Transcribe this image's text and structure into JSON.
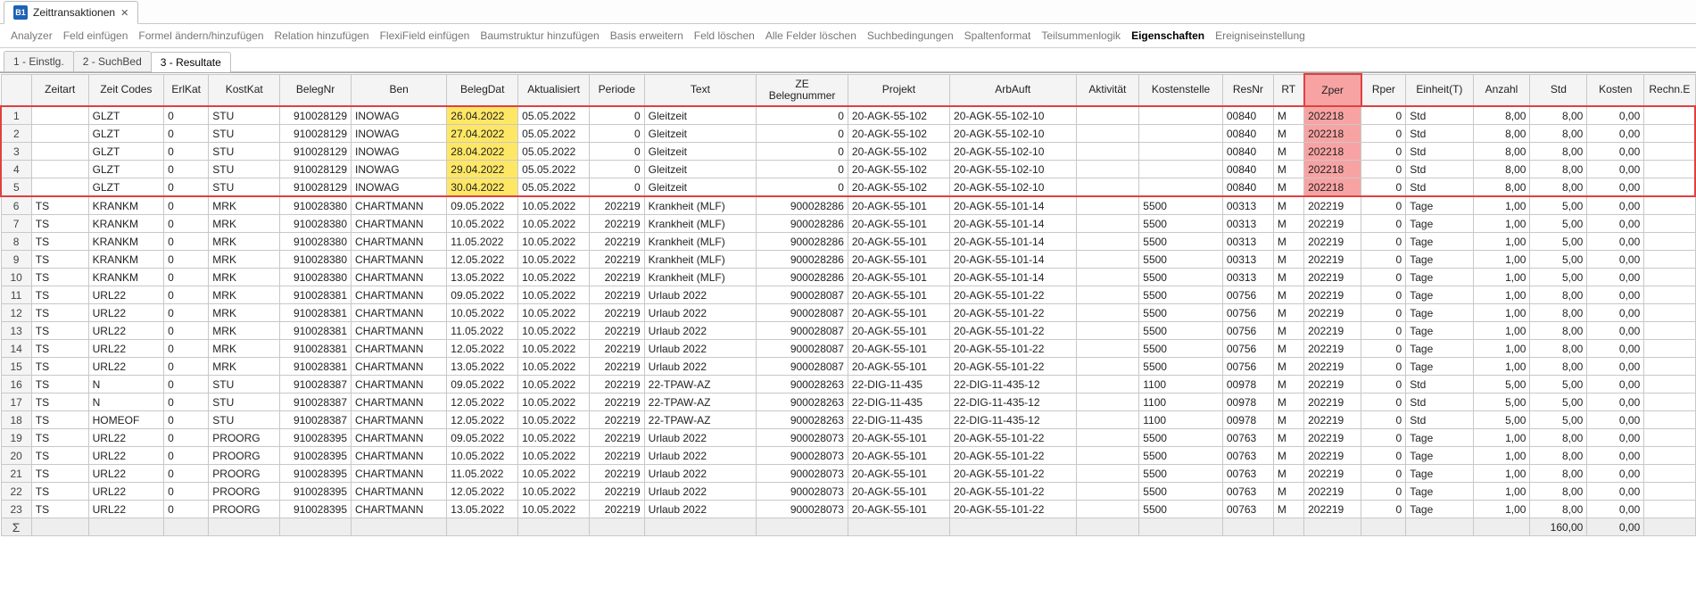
{
  "app_icon_text": "B1",
  "window_title": "Zeittransaktionen",
  "menu": {
    "items": [
      "Analyzer",
      "Feld einfügen",
      "Formel ändern/hinzufügen",
      "Relation hinzufügen",
      "FlexiField einfügen",
      "Baumstruktur hinzufügen",
      "Basis erweitern",
      "Feld löschen",
      "Alle Felder löschen",
      "Suchbedingungen",
      "Spaltenformat",
      "Teilsummenlogik",
      "Eigenschaften",
      "Ereigniseinstellung"
    ],
    "active_index": 12
  },
  "sub_tabs": {
    "items": [
      "1 - Einstlg.",
      "2 - SuchBed",
      "3 - Resultate"
    ],
    "active_index": 2
  },
  "columns": [
    "",
    "Zeitart",
    "Zeit Codes",
    "ErlKat",
    "KostKat",
    "BelegNr",
    "Ben",
    "BelegDat",
    "Aktualisiert",
    "Periode",
    "Text",
    "ZE Belegnummer",
    "Projekt",
    "ArbAuft",
    "Aktivität",
    "Kostenstelle",
    "ResNr",
    "RT",
    "Zper",
    "Rper",
    "Einheit(T)",
    "Anzahl",
    "Std",
    "Kosten",
    "Rechn.E"
  ],
  "highlight_rows": 5,
  "rows": [
    {
      "n": "1",
      "zeitart": "",
      "zc": "GLZT",
      "erl": "0",
      "kk": "STU",
      "bnr": "910028129",
      "ben": "INOWAG",
      "bdat": "26.04.2022",
      "akt": "05.05.2022",
      "per": "0",
      "text": "Gleitzeit",
      "zeb": "0",
      "proj": "20-AGK-55-102",
      "arb": "20-AGK-55-102-10",
      "aktv": "",
      "kost": "",
      "res": "00840",
      "rt": "M",
      "zper": "202218",
      "rper": "0",
      "einh": "Std",
      "anz": "8,00",
      "std": "8,00",
      "kosten": "0,00",
      "rechn": ""
    },
    {
      "n": "2",
      "zeitart": "",
      "zc": "GLZT",
      "erl": "0",
      "kk": "STU",
      "bnr": "910028129",
      "ben": "INOWAG",
      "bdat": "27.04.2022",
      "akt": "05.05.2022",
      "per": "0",
      "text": "Gleitzeit",
      "zeb": "0",
      "proj": "20-AGK-55-102",
      "arb": "20-AGK-55-102-10",
      "aktv": "",
      "kost": "",
      "res": "00840",
      "rt": "M",
      "zper": "202218",
      "rper": "0",
      "einh": "Std",
      "anz": "8,00",
      "std": "8,00",
      "kosten": "0,00",
      "rechn": ""
    },
    {
      "n": "3",
      "zeitart": "",
      "zc": "GLZT",
      "erl": "0",
      "kk": "STU",
      "bnr": "910028129",
      "ben": "INOWAG",
      "bdat": "28.04.2022",
      "akt": "05.05.2022",
      "per": "0",
      "text": "Gleitzeit",
      "zeb": "0",
      "proj": "20-AGK-55-102",
      "arb": "20-AGK-55-102-10",
      "aktv": "",
      "kost": "",
      "res": "00840",
      "rt": "M",
      "zper": "202218",
      "rper": "0",
      "einh": "Std",
      "anz": "8,00",
      "std": "8,00",
      "kosten": "0,00",
      "rechn": ""
    },
    {
      "n": "4",
      "zeitart": "",
      "zc": "GLZT",
      "erl": "0",
      "kk": "STU",
      "bnr": "910028129",
      "ben": "INOWAG",
      "bdat": "29.04.2022",
      "akt": "05.05.2022",
      "per": "0",
      "text": "Gleitzeit",
      "zeb": "0",
      "proj": "20-AGK-55-102",
      "arb": "20-AGK-55-102-10",
      "aktv": "",
      "kost": "",
      "res": "00840",
      "rt": "M",
      "zper": "202218",
      "rper": "0",
      "einh": "Std",
      "anz": "8,00",
      "std": "8,00",
      "kosten": "0,00",
      "rechn": ""
    },
    {
      "n": "5",
      "zeitart": "",
      "zc": "GLZT",
      "erl": "0",
      "kk": "STU",
      "bnr": "910028129",
      "ben": "INOWAG",
      "bdat": "30.04.2022",
      "akt": "05.05.2022",
      "per": "0",
      "text": "Gleitzeit",
      "zeb": "0",
      "proj": "20-AGK-55-102",
      "arb": "20-AGK-55-102-10",
      "aktv": "",
      "kost": "",
      "res": "00840",
      "rt": "M",
      "zper": "202218",
      "rper": "0",
      "einh": "Std",
      "anz": "8,00",
      "std": "8,00",
      "kosten": "0,00",
      "rechn": ""
    },
    {
      "n": "6",
      "zeitart": "TS",
      "zc": "KRANKM",
      "erl": "0",
      "kk": "MRK",
      "bnr": "910028380",
      "ben": "CHARTMANN",
      "bdat": "09.05.2022",
      "akt": "10.05.2022",
      "per": "202219",
      "text": "Krankheit (MLF)",
      "zeb": "900028286",
      "proj": "20-AGK-55-101",
      "arb": "20-AGK-55-101-14",
      "aktv": "",
      "kost": "5500",
      "res": "00313",
      "rt": "M",
      "zper": "202219",
      "rper": "0",
      "einh": "Tage",
      "anz": "1,00",
      "std": "5,00",
      "kosten": "0,00",
      "rechn": ""
    },
    {
      "n": "7",
      "zeitart": "TS",
      "zc": "KRANKM",
      "erl": "0",
      "kk": "MRK",
      "bnr": "910028380",
      "ben": "CHARTMANN",
      "bdat": "10.05.2022",
      "akt": "10.05.2022",
      "per": "202219",
      "text": "Krankheit (MLF)",
      "zeb": "900028286",
      "proj": "20-AGK-55-101",
      "arb": "20-AGK-55-101-14",
      "aktv": "",
      "kost": "5500",
      "res": "00313",
      "rt": "M",
      "zper": "202219",
      "rper": "0",
      "einh": "Tage",
      "anz": "1,00",
      "std": "5,00",
      "kosten": "0,00",
      "rechn": ""
    },
    {
      "n": "8",
      "zeitart": "TS",
      "zc": "KRANKM",
      "erl": "0",
      "kk": "MRK",
      "bnr": "910028380",
      "ben": "CHARTMANN",
      "bdat": "11.05.2022",
      "akt": "10.05.2022",
      "per": "202219",
      "text": "Krankheit (MLF)",
      "zeb": "900028286",
      "proj": "20-AGK-55-101",
      "arb": "20-AGK-55-101-14",
      "aktv": "",
      "kost": "5500",
      "res": "00313",
      "rt": "M",
      "zper": "202219",
      "rper": "0",
      "einh": "Tage",
      "anz": "1,00",
      "std": "5,00",
      "kosten": "0,00",
      "rechn": ""
    },
    {
      "n": "9",
      "zeitart": "TS",
      "zc": "KRANKM",
      "erl": "0",
      "kk": "MRK",
      "bnr": "910028380",
      "ben": "CHARTMANN",
      "bdat": "12.05.2022",
      "akt": "10.05.2022",
      "per": "202219",
      "text": "Krankheit (MLF)",
      "zeb": "900028286",
      "proj": "20-AGK-55-101",
      "arb": "20-AGK-55-101-14",
      "aktv": "",
      "kost": "5500",
      "res": "00313",
      "rt": "M",
      "zper": "202219",
      "rper": "0",
      "einh": "Tage",
      "anz": "1,00",
      "std": "5,00",
      "kosten": "0,00",
      "rechn": ""
    },
    {
      "n": "10",
      "zeitart": "TS",
      "zc": "KRANKM",
      "erl": "0",
      "kk": "MRK",
      "bnr": "910028380",
      "ben": "CHARTMANN",
      "bdat": "13.05.2022",
      "akt": "10.05.2022",
      "per": "202219",
      "text": "Krankheit (MLF)",
      "zeb": "900028286",
      "proj": "20-AGK-55-101",
      "arb": "20-AGK-55-101-14",
      "aktv": "",
      "kost": "5500",
      "res": "00313",
      "rt": "M",
      "zper": "202219",
      "rper": "0",
      "einh": "Tage",
      "anz": "1,00",
      "std": "5,00",
      "kosten": "0,00",
      "rechn": ""
    },
    {
      "n": "11",
      "zeitart": "TS",
      "zc": "URL22",
      "erl": "0",
      "kk": "MRK",
      "bnr": "910028381",
      "ben": "CHARTMANN",
      "bdat": "09.05.2022",
      "akt": "10.05.2022",
      "per": "202219",
      "text": "Urlaub 2022",
      "zeb": "900028087",
      "proj": "20-AGK-55-101",
      "arb": "20-AGK-55-101-22",
      "aktv": "",
      "kost": "5500",
      "res": "00756",
      "rt": "M",
      "zper": "202219",
      "rper": "0",
      "einh": "Tage",
      "anz": "1,00",
      "std": "8,00",
      "kosten": "0,00",
      "rechn": ""
    },
    {
      "n": "12",
      "zeitart": "TS",
      "zc": "URL22",
      "erl": "0",
      "kk": "MRK",
      "bnr": "910028381",
      "ben": "CHARTMANN",
      "bdat": "10.05.2022",
      "akt": "10.05.2022",
      "per": "202219",
      "text": "Urlaub 2022",
      "zeb": "900028087",
      "proj": "20-AGK-55-101",
      "arb": "20-AGK-55-101-22",
      "aktv": "",
      "kost": "5500",
      "res": "00756",
      "rt": "M",
      "zper": "202219",
      "rper": "0",
      "einh": "Tage",
      "anz": "1,00",
      "std": "8,00",
      "kosten": "0,00",
      "rechn": ""
    },
    {
      "n": "13",
      "zeitart": "TS",
      "zc": "URL22",
      "erl": "0",
      "kk": "MRK",
      "bnr": "910028381",
      "ben": "CHARTMANN",
      "bdat": "11.05.2022",
      "akt": "10.05.2022",
      "per": "202219",
      "text": "Urlaub 2022",
      "zeb": "900028087",
      "proj": "20-AGK-55-101",
      "arb": "20-AGK-55-101-22",
      "aktv": "",
      "kost": "5500",
      "res": "00756",
      "rt": "M",
      "zper": "202219",
      "rper": "0",
      "einh": "Tage",
      "anz": "1,00",
      "std": "8,00",
      "kosten": "0,00",
      "rechn": ""
    },
    {
      "n": "14",
      "zeitart": "TS",
      "zc": "URL22",
      "erl": "0",
      "kk": "MRK",
      "bnr": "910028381",
      "ben": "CHARTMANN",
      "bdat": "12.05.2022",
      "akt": "10.05.2022",
      "per": "202219",
      "text": "Urlaub 2022",
      "zeb": "900028087",
      "proj": "20-AGK-55-101",
      "arb": "20-AGK-55-101-22",
      "aktv": "",
      "kost": "5500",
      "res": "00756",
      "rt": "M",
      "zper": "202219",
      "rper": "0",
      "einh": "Tage",
      "anz": "1,00",
      "std": "8,00",
      "kosten": "0,00",
      "rechn": ""
    },
    {
      "n": "15",
      "zeitart": "TS",
      "zc": "URL22",
      "erl": "0",
      "kk": "MRK",
      "bnr": "910028381",
      "ben": "CHARTMANN",
      "bdat": "13.05.2022",
      "akt": "10.05.2022",
      "per": "202219",
      "text": "Urlaub 2022",
      "zeb": "900028087",
      "proj": "20-AGK-55-101",
      "arb": "20-AGK-55-101-22",
      "aktv": "",
      "kost": "5500",
      "res": "00756",
      "rt": "M",
      "zper": "202219",
      "rper": "0",
      "einh": "Tage",
      "anz": "1,00",
      "std": "8,00",
      "kosten": "0,00",
      "rechn": ""
    },
    {
      "n": "16",
      "zeitart": "TS",
      "zc": "N",
      "erl": "0",
      "kk": "STU",
      "bnr": "910028387",
      "ben": "CHARTMANN",
      "bdat": "09.05.2022",
      "akt": "10.05.2022",
      "per": "202219",
      "text": "22-TPAW-AZ",
      "zeb": "900028263",
      "proj": "22-DIG-11-435",
      "arb": "22-DIG-11-435-12",
      "aktv": "",
      "kost": "1100",
      "res": "00978",
      "rt": "M",
      "zper": "202219",
      "rper": "0",
      "einh": "Std",
      "anz": "5,00",
      "std": "5,00",
      "kosten": "0,00",
      "rechn": ""
    },
    {
      "n": "17",
      "zeitart": "TS",
      "zc": "N",
      "erl": "0",
      "kk": "STU",
      "bnr": "910028387",
      "ben": "CHARTMANN",
      "bdat": "12.05.2022",
      "akt": "10.05.2022",
      "per": "202219",
      "text": "22-TPAW-AZ",
      "zeb": "900028263",
      "proj": "22-DIG-11-435",
      "arb": "22-DIG-11-435-12",
      "aktv": "",
      "kost": "1100",
      "res": "00978",
      "rt": "M",
      "zper": "202219",
      "rper": "0",
      "einh": "Std",
      "anz": "5,00",
      "std": "5,00",
      "kosten": "0,00",
      "rechn": ""
    },
    {
      "n": "18",
      "zeitart": "TS",
      "zc": "HOMEOF",
      "erl": "0",
      "kk": "STU",
      "bnr": "910028387",
      "ben": "CHARTMANN",
      "bdat": "12.05.2022",
      "akt": "10.05.2022",
      "per": "202219",
      "text": "22-TPAW-AZ",
      "zeb": "900028263",
      "proj": "22-DIG-11-435",
      "arb": "22-DIG-11-435-12",
      "aktv": "",
      "kost": "1100",
      "res": "00978",
      "rt": "M",
      "zper": "202219",
      "rper": "0",
      "einh": "Std",
      "anz": "5,00",
      "std": "5,00",
      "kosten": "0,00",
      "rechn": ""
    },
    {
      "n": "19",
      "zeitart": "TS",
      "zc": "URL22",
      "erl": "0",
      "kk": "PROORG",
      "bnr": "910028395",
      "ben": "CHARTMANN",
      "bdat": "09.05.2022",
      "akt": "10.05.2022",
      "per": "202219",
      "text": "Urlaub 2022",
      "zeb": "900028073",
      "proj": "20-AGK-55-101",
      "arb": "20-AGK-55-101-22",
      "aktv": "",
      "kost": "5500",
      "res": "00763",
      "rt": "M",
      "zper": "202219",
      "rper": "0",
      "einh": "Tage",
      "anz": "1,00",
      "std": "8,00",
      "kosten": "0,00",
      "rechn": ""
    },
    {
      "n": "20",
      "zeitart": "TS",
      "zc": "URL22",
      "erl": "0",
      "kk": "PROORG",
      "bnr": "910028395",
      "ben": "CHARTMANN",
      "bdat": "10.05.2022",
      "akt": "10.05.2022",
      "per": "202219",
      "text": "Urlaub 2022",
      "zeb": "900028073",
      "proj": "20-AGK-55-101",
      "arb": "20-AGK-55-101-22",
      "aktv": "",
      "kost": "5500",
      "res": "00763",
      "rt": "M",
      "zper": "202219",
      "rper": "0",
      "einh": "Tage",
      "anz": "1,00",
      "std": "8,00",
      "kosten": "0,00",
      "rechn": ""
    },
    {
      "n": "21",
      "zeitart": "TS",
      "zc": "URL22",
      "erl": "0",
      "kk": "PROORG",
      "bnr": "910028395",
      "ben": "CHARTMANN",
      "bdat": "11.05.2022",
      "akt": "10.05.2022",
      "per": "202219",
      "text": "Urlaub 2022",
      "zeb": "900028073",
      "proj": "20-AGK-55-101",
      "arb": "20-AGK-55-101-22",
      "aktv": "",
      "kost": "5500",
      "res": "00763",
      "rt": "M",
      "zper": "202219",
      "rper": "0",
      "einh": "Tage",
      "anz": "1,00",
      "std": "8,00",
      "kosten": "0,00",
      "rechn": ""
    },
    {
      "n": "22",
      "zeitart": "TS",
      "zc": "URL22",
      "erl": "0",
      "kk": "PROORG",
      "bnr": "910028395",
      "ben": "CHARTMANN",
      "bdat": "12.05.2022",
      "akt": "10.05.2022",
      "per": "202219",
      "text": "Urlaub 2022",
      "zeb": "900028073",
      "proj": "20-AGK-55-101",
      "arb": "20-AGK-55-101-22",
      "aktv": "",
      "kost": "5500",
      "res": "00763",
      "rt": "M",
      "zper": "202219",
      "rper": "0",
      "einh": "Tage",
      "anz": "1,00",
      "std": "8,00",
      "kosten": "0,00",
      "rechn": ""
    },
    {
      "n": "23",
      "zeitart": "TS",
      "zc": "URL22",
      "erl": "0",
      "kk": "PROORG",
      "bnr": "910028395",
      "ben": "CHARTMANN",
      "bdat": "13.05.2022",
      "akt": "10.05.2022",
      "per": "202219",
      "text": "Urlaub 2022",
      "zeb": "900028073",
      "proj": "20-AGK-55-101",
      "arb": "20-AGK-55-101-22",
      "aktv": "",
      "kost": "5500",
      "res": "00763",
      "rt": "M",
      "zper": "202219",
      "rper": "0",
      "einh": "Tage",
      "anz": "1,00",
      "std": "8,00",
      "kosten": "0,00",
      "rechn": ""
    }
  ],
  "sum_row": {
    "symbol": "Σ",
    "std": "160,00",
    "kosten": "0,00"
  }
}
